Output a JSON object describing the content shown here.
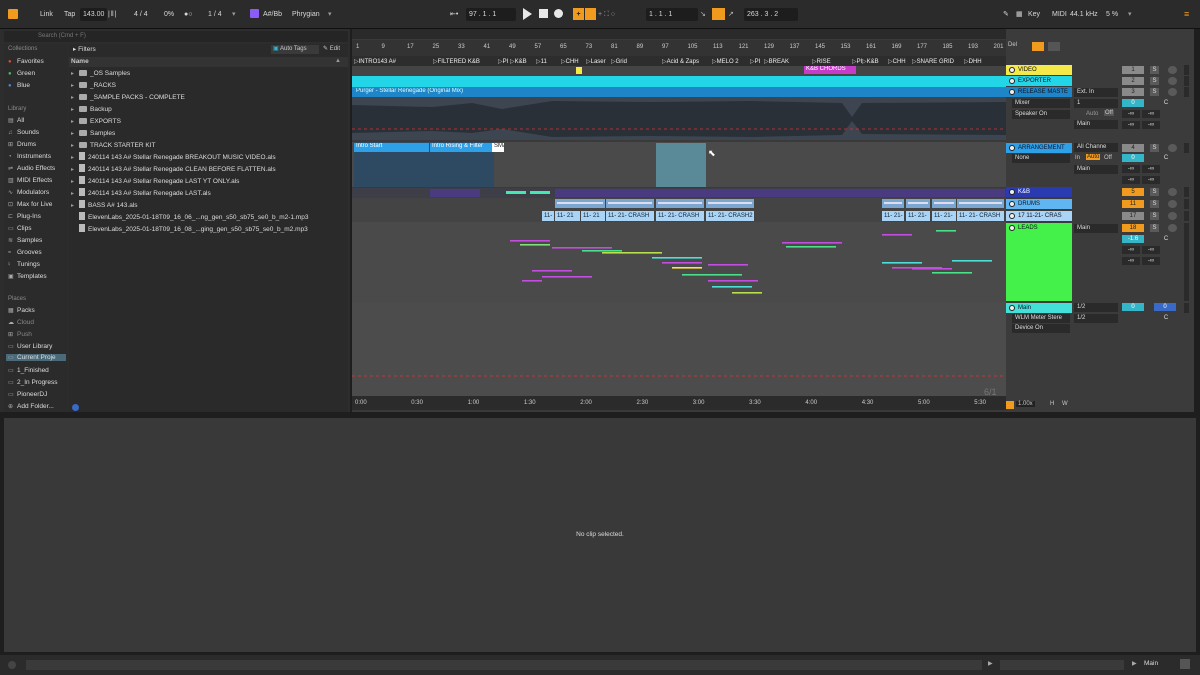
{
  "transport": {
    "link": "Link",
    "tap": "Tap",
    "tempo": "143.00",
    "signature": "4 / 4",
    "cpu_pct": "0%",
    "quantize": "1 / 4",
    "key": "A#/Bb",
    "scale": "Phrygian",
    "position": "97 .  1 .  1",
    "loop_start": "1 .  1 .  1",
    "loop_length": "263 .  3 .  2",
    "key_label": "Key",
    "midi_label": "MIDI",
    "sample_rate": "44.1 kHz",
    "cpu_load": "5 %"
  },
  "browser": {
    "search_placeholder": "Search (Cmd + F)",
    "filters": "Filters",
    "auto_tags": "Auto Tags",
    "edit": "Edit",
    "collections_header": "Collections",
    "collections": [
      {
        "label": "Favorites",
        "color": "#e0483c"
      },
      {
        "label": "Green",
        "color": "#3fc35a"
      },
      {
        "label": "Blue",
        "color": "#3a8de0"
      }
    ],
    "library_header": "Library",
    "library": [
      "All",
      "Sounds",
      "Drums",
      "Instruments",
      "Audio Effects",
      "MIDI Effects",
      "Modulators",
      "Max for Live",
      "Plug-Ins",
      "Clips",
      "Samples",
      "Grooves",
      "Tunings",
      "Templates"
    ],
    "places_header": "Places",
    "places": [
      "Packs",
      "Cloud",
      "Push",
      "User Library",
      "Current Proje",
      "1_Finished",
      "2_In Progress",
      "PioneerDJ",
      "Add Folder..."
    ],
    "column_name": "Name",
    "files": [
      {
        "name": "_OS Samples",
        "kind": "folder"
      },
      {
        "name": "_RACKS",
        "kind": "folder"
      },
      {
        "name": "_SAMPLE PACKS - COMPLETE",
        "kind": "folder"
      },
      {
        "name": "Backup",
        "kind": "folder"
      },
      {
        "name": "EXPORTS",
        "kind": "folder"
      },
      {
        "name": "Samples",
        "kind": "folder"
      },
      {
        "name": "TRACK STARTER KIT",
        "kind": "folder"
      },
      {
        "name": "240114 143 A# Stellar Renegade BREAKOUT MUSIC VIDEO.als",
        "kind": "file"
      },
      {
        "name": "240114 143 A# Stellar Renegade CLEAN BEFORE FLATTEN.als",
        "kind": "file"
      },
      {
        "name": "240114 143 A# Stellar Renegade LAST YT ONLY.als",
        "kind": "file"
      },
      {
        "name": "240114 143 A# Stellar Renegade LAST.als",
        "kind": "file"
      },
      {
        "name": "BASS A# 143.als",
        "kind": "file"
      },
      {
        "name": "ElevenLabs_2025-01-18T09_16_06_...ng_gen_s50_sb75_se0_b_m2-1.mp3",
        "kind": "audio"
      },
      {
        "name": "ElevenLabs_2025-01-18T09_16_08_...ging_gen_s50_sb75_se0_b_m2.mp3",
        "kind": "audio"
      }
    ]
  },
  "ruler": [
    "1",
    "9",
    "17",
    "25",
    "33",
    "41",
    "49",
    "57",
    "65",
    "73",
    "81",
    "89",
    "97",
    "105",
    "113",
    "121",
    "129",
    "137",
    "145",
    "153",
    "161",
    "169",
    "177",
    "185",
    "193",
    "201"
  ],
  "locators": [
    "INTRO143 A#",
    "FILTERED K&B",
    "PI",
    "K&B",
    "11",
    "CHH",
    "Laser",
    "Grid",
    "Acid & Zaps",
    "MELO 2",
    "PI",
    "BREAK",
    "RISE",
    "PI",
    "K&B",
    "CHH",
    "SNARE GRID",
    "DHH"
  ],
  "clips": {
    "release_master": "Purger - Stellar Renegade (Original Mix)",
    "arr_intro": "Intro Start",
    "arr_rising": "Intro Rising & Filter",
    "arr_sma": "SMA",
    "crash_a": "11-",
    "crash_b": "11- 21",
    "crash_c": "11- 21",
    "crash_d": "11- 21- CRASH",
    "crash_e": "11- 21- CRASH",
    "crash_f": "11- 21- CRASH2",
    "crash_g": "11- 21-",
    "crash_h": "11- 21-",
    "crash_i": "11- 21-",
    "crash_j": "11- 21- CRASH",
    "break_badge": "K&B CHORDS"
  },
  "timeline": [
    "0:00",
    "0:30",
    "1:00",
    "1:30",
    "2:00",
    "2:30",
    "3:00",
    "3:30",
    "4:00",
    "4:30",
    "5:00",
    "5:30"
  ],
  "page_count": "6/1",
  "zoom": "1.00x",
  "tracks": [
    {
      "name": "VIDEO",
      "color": "#f5e94a",
      "num": "1"
    },
    {
      "name": "EXPORTER",
      "color": "#22d6e8",
      "num": "2"
    },
    {
      "name": "RELEASE MASTE",
      "color": "#1e86c8",
      "num": "3"
    },
    {
      "name": "ARRANGEMENT",
      "color": "#2ea0e8",
      "num": "4"
    },
    {
      "name": "K&B",
      "color": "#2a3ab0",
      "num": "5"
    },
    {
      "name": "DRUMS",
      "color": "#5fb6f0",
      "num": "11"
    },
    {
      "name": "17 11-21- CRAS",
      "color": "#a9d4f5",
      "num": "17"
    },
    {
      "name": "LEADS",
      "color": "#44f04a",
      "num": "18"
    },
    {
      "name": "Main",
      "color": "#42e0d6",
      "num": ""
    }
  ],
  "mixer": {
    "ext_in": "Ext. In",
    "input_ch": "1",
    "main": "Main",
    "mixer_label": "Mixer",
    "speaker_on": "Speaker On",
    "auto": "Auto",
    "off": "Off",
    "in": "In",
    "all_channels": "All Channe",
    "none": "None",
    "vol_zero": "0",
    "vol_neg": "-1.6",
    "neg_inf": "-∞",
    "center": "C",
    "wlm": "WLM Meter Stere",
    "device_on": "Device On",
    "half": "1/2",
    "half2": "1/2",
    "master_vol": "0",
    "master_pan": "0",
    "solo": "S",
    "del": "Del",
    "h": "H",
    "w": "W"
  },
  "detail": {
    "message": "No clip selected."
  },
  "status": {
    "main": "Main"
  }
}
